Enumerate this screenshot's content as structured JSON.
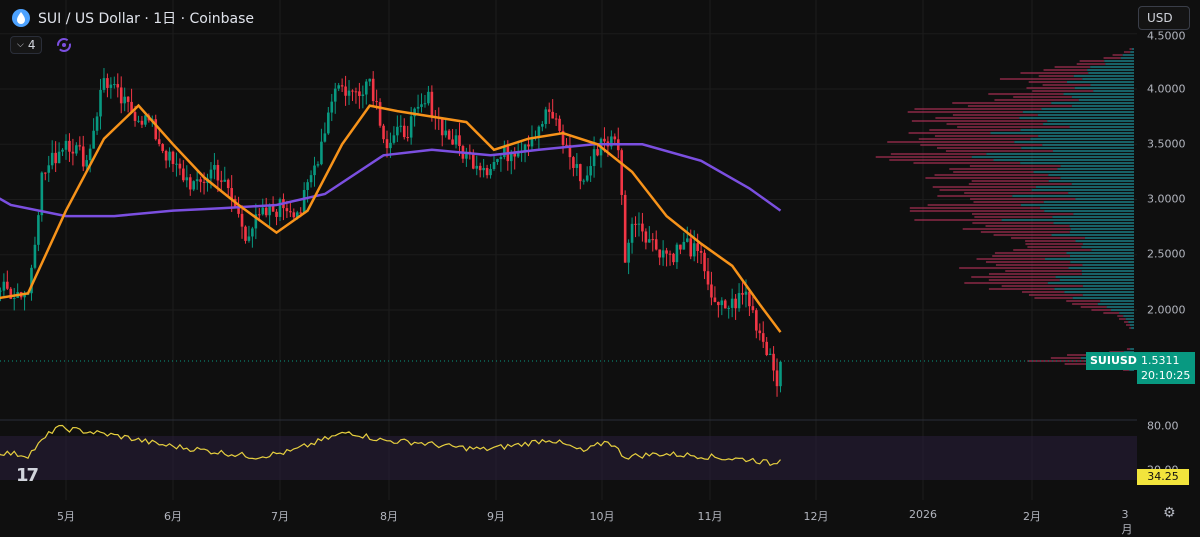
{
  "header": {
    "title": "SUI / US Dollar · 1日 · Coinbase",
    "indicator_count": "4"
  },
  "currency_selector": "USD",
  "price_axis": [
    "4.5000",
    "4.0000",
    "3.5000",
    "3.0000",
    "2.5000",
    "2.0000"
  ],
  "rsi_axis": [
    "80.00",
    "20.00"
  ],
  "time_axis": [
    "5月",
    "6月",
    "7月",
    "8月",
    "9月",
    "10月",
    "11月",
    "12月",
    "2026",
    "2月",
    "3月"
  ],
  "symbol_label": "SUIUSD",
  "last_price": "1.5311",
  "countdown": "20:10:25",
  "rsi_value": "34.25",
  "colors": {
    "up": "#089981",
    "down": "#f23645",
    "ma_short": "#f7931a",
    "ma_long": "#7b4fe0",
    "rsi": "#e6cf3f",
    "vp_up": "#22aab5",
    "vp_down": "#c0335e",
    "background": "#0f0f0f"
  },
  "chart_data": {
    "type": "candlestick",
    "symbol": "SUI / US Dollar",
    "interval": "1日",
    "exchange": "Coinbase",
    "ylim": [
      1.35,
      4.5
    ],
    "close_series": [
      {
        "x": "2025-04-10",
        "y": 2.2
      },
      {
        "x": "2025-04-20",
        "y": 2.15
      },
      {
        "x": "2025-04-24",
        "y": 3.2
      },
      {
        "x": "2025-05-01",
        "y": 3.55
      },
      {
        "x": "2025-05-07",
        "y": 3.35
      },
      {
        "x": "2025-05-12",
        "y": 4.1
      },
      {
        "x": "2025-05-18",
        "y": 3.85
      },
      {
        "x": "2025-05-25",
        "y": 3.7
      },
      {
        "x": "2025-06-01",
        "y": 3.3
      },
      {
        "x": "2025-06-08",
        "y": 3.1
      },
      {
        "x": "2025-06-13",
        "y": 3.3
      },
      {
        "x": "2025-06-18",
        "y": 3.0
      },
      {
        "x": "2025-06-22",
        "y": 2.7
      },
      {
        "x": "2025-06-27",
        "y": 2.85
      },
      {
        "x": "2025-07-03",
        "y": 2.95
      },
      {
        "x": "2025-07-08",
        "y": 2.9
      },
      {
        "x": "2025-07-13",
        "y": 3.4
      },
      {
        "x": "2025-07-18",
        "y": 4.05
      },
      {
        "x": "2025-07-23",
        "y": 3.95
      },
      {
        "x": "2025-07-28",
        "y": 4.1
      },
      {
        "x": "2025-08-02",
        "y": 3.5
      },
      {
        "x": "2025-08-08",
        "y": 3.65
      },
      {
        "x": "2025-08-14",
        "y": 3.9
      },
      {
        "x": "2025-08-19",
        "y": 3.6
      },
      {
        "x": "2025-08-25",
        "y": 3.4
      },
      {
        "x": "2025-08-31",
        "y": 3.3
      },
      {
        "x": "2025-09-05",
        "y": 3.4
      },
      {
        "x": "2025-09-12",
        "y": 3.55
      },
      {
        "x": "2025-09-18",
        "y": 3.8
      },
      {
        "x": "2025-09-23",
        "y": 3.45
      },
      {
        "x": "2025-09-28",
        "y": 3.15
      },
      {
        "x": "2025-10-03",
        "y": 3.55
      },
      {
        "x": "2025-10-08",
        "y": 3.5
      },
      {
        "x": "2025-10-10",
        "y": 2.5
      },
      {
        "x": "2025-10-13",
        "y": 2.85
      },
      {
        "x": "2025-10-18",
        "y": 2.6
      },
      {
        "x": "2025-10-23",
        "y": 2.5
      },
      {
        "x": "2025-10-28",
        "y": 2.6
      },
      {
        "x": "2025-11-02",
        "y": 2.4
      },
      {
        "x": "2025-11-05",
        "y": 2.0
      },
      {
        "x": "2025-11-10",
        "y": 2.05
      },
      {
        "x": "2025-11-14",
        "y": 2.15
      },
      {
        "x": "2025-11-18",
        "y": 1.8
      },
      {
        "x": "2025-11-21",
        "y": 1.6
      },
      {
        "x": "2025-11-23",
        "y": 1.4
      },
      {
        "x": "2025-11-24",
        "y": 1.5311
      }
    ],
    "ma_short": [
      {
        "x": "2025-04-10",
        "y": 2.1
      },
      {
        "x": "2025-04-20",
        "y": 2.15
      },
      {
        "x": "2025-05-01",
        "y": 2.9
      },
      {
        "x": "2025-05-12",
        "y": 3.55
      },
      {
        "x": "2025-05-22",
        "y": 3.85
      },
      {
        "x": "2025-06-01",
        "y": 3.5
      },
      {
        "x": "2025-06-10",
        "y": 3.2
      },
      {
        "x": "2025-06-20",
        "y": 2.95
      },
      {
        "x": "2025-07-01",
        "y": 2.7
      },
      {
        "x": "2025-07-10",
        "y": 2.9
      },
      {
        "x": "2025-07-20",
        "y": 3.5
      },
      {
        "x": "2025-07-28",
        "y": 3.85
      },
      {
        "x": "2025-08-05",
        "y": 3.8
      },
      {
        "x": "2025-08-15",
        "y": 3.75
      },
      {
        "x": "2025-08-25",
        "y": 3.7
      },
      {
        "x": "2025-09-02",
        "y": 3.45
      },
      {
        "x": "2025-09-12",
        "y": 3.55
      },
      {
        "x": "2025-09-22",
        "y": 3.6
      },
      {
        "x": "2025-10-02",
        "y": 3.5
      },
      {
        "x": "2025-10-12",
        "y": 3.25
      },
      {
        "x": "2025-10-22",
        "y": 2.85
      },
      {
        "x": "2025-11-01",
        "y": 2.6
      },
      {
        "x": "2025-11-10",
        "y": 2.4
      },
      {
        "x": "2025-11-18",
        "y": 2.05
      },
      {
        "x": "2025-11-24",
        "y": 1.8
      }
    ],
    "ma_long": [
      {
        "x": "2025-04-01",
        "y": 3.2
      },
      {
        "x": "2025-04-15",
        "y": 2.95
      },
      {
        "x": "2025-05-01",
        "y": 2.85
      },
      {
        "x": "2025-05-15",
        "y": 2.85
      },
      {
        "x": "2025-06-01",
        "y": 2.9
      },
      {
        "x": "2025-06-15",
        "y": 2.92
      },
      {
        "x": "2025-07-01",
        "y": 2.95
      },
      {
        "x": "2025-07-15",
        "y": 3.05
      },
      {
        "x": "2025-08-01",
        "y": 3.4
      },
      {
        "x": "2025-08-15",
        "y": 3.45
      },
      {
        "x": "2025-09-01",
        "y": 3.4
      },
      {
        "x": "2025-09-15",
        "y": 3.45
      },
      {
        "x": "2025-10-01",
        "y": 3.5
      },
      {
        "x": "2025-10-15",
        "y": 3.5
      },
      {
        "x": "2025-11-01",
        "y": 3.35
      },
      {
        "x": "2025-11-15",
        "y": 3.1
      },
      {
        "x": "2025-11-24",
        "y": 2.9
      }
    ],
    "rsi": {
      "value": 34.25,
      "levels": [
        80,
        20
      ],
      "points": [
        {
          "x": "2025-04-10",
          "y": 45
        },
        {
          "x": "2025-04-20",
          "y": 40
        },
        {
          "x": "2025-04-28",
          "y": 78
        },
        {
          "x": "2025-05-08",
          "y": 72
        },
        {
          "x": "2025-05-18",
          "y": 65
        },
        {
          "x": "2025-05-28",
          "y": 55
        },
        {
          "x": "2025-06-08",
          "y": 48
        },
        {
          "x": "2025-06-18",
          "y": 42
        },
        {
          "x": "2025-06-25",
          "y": 38
        },
        {
          "x": "2025-07-05",
          "y": 45
        },
        {
          "x": "2025-07-15",
          "y": 62
        },
        {
          "x": "2025-07-22",
          "y": 72
        },
        {
          "x": "2025-08-01",
          "y": 60
        },
        {
          "x": "2025-08-10",
          "y": 58
        },
        {
          "x": "2025-08-20",
          "y": 52
        },
        {
          "x": "2025-08-30",
          "y": 48
        },
        {
          "x": "2025-09-10",
          "y": 55
        },
        {
          "x": "2025-09-18",
          "y": 62
        },
        {
          "x": "2025-09-28",
          "y": 45
        },
        {
          "x": "2025-10-05",
          "y": 60
        },
        {
          "x": "2025-10-10",
          "y": 38
        },
        {
          "x": "2025-10-20",
          "y": 42
        },
        {
          "x": "2025-10-30",
          "y": 40
        },
        {
          "x": "2025-11-08",
          "y": 36
        },
        {
          "x": "2025-11-16",
          "y": 34
        },
        {
          "x": "2025-11-22",
          "y": 28
        },
        {
          "x": "2025-11-24",
          "y": 34.25
        }
      ]
    }
  }
}
